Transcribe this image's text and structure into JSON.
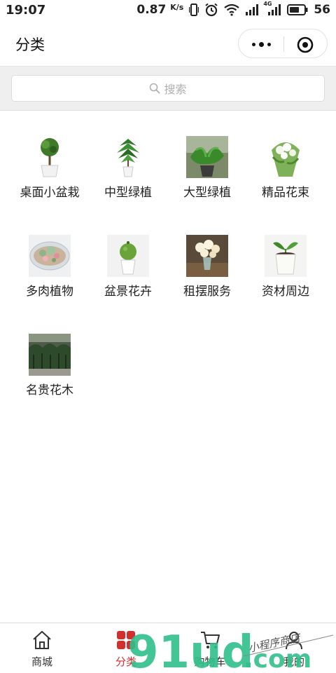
{
  "status_bar": {
    "time": "19:07",
    "speed": "0.87",
    "speed_unit": "K/s",
    "network": "4G",
    "battery": "56"
  },
  "nav": {
    "title": "分类"
  },
  "search": {
    "placeholder": "搜索"
  },
  "categories": [
    {
      "label": "桌面小盆栽",
      "icon": "topiary-plant-image"
    },
    {
      "label": "中型绿植",
      "icon": "money-tree-image"
    },
    {
      "label": "大型绿植",
      "icon": "large-plant-image"
    },
    {
      "label": "精品花束",
      "icon": "flower-bouquet-image"
    },
    {
      "label": "多肉植物",
      "icon": "succulent-bowl-image"
    },
    {
      "label": "盆景花卉",
      "icon": "moss-ball-image"
    },
    {
      "label": "租摆服务",
      "icon": "flower-vase-image"
    },
    {
      "label": "资材周边",
      "icon": "seedling-pot-image"
    },
    {
      "label": "名贵花木",
      "icon": "nursery-image"
    }
  ],
  "tabs": [
    {
      "label": "商城",
      "icon": "home-icon"
    },
    {
      "label": "分类",
      "icon": "category-grid-icon",
      "active": true
    },
    {
      "label": "购物车",
      "icon": "cart-icon"
    },
    {
      "label": "我的",
      "icon": "user-icon"
    }
  ],
  "watermark": {
    "logo": "91ud",
    "domain": ".com",
    "script": "小程序商店"
  },
  "colors": {
    "accent": "#d32f2f",
    "search_bg": "#efefef",
    "watermark_green": "#2fbf8a"
  }
}
